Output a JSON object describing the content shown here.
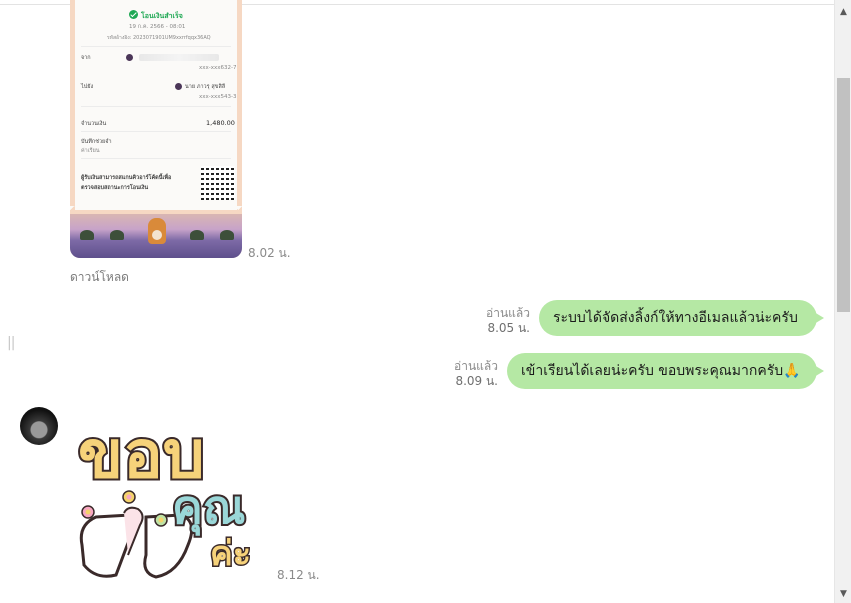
{
  "receipt": {
    "status": "โอนเงินสำเร็จ",
    "date": "19 ก.ค. 2566 - 08:01",
    "ref": "รหัสอ้างอิง: 2023071901UM9xxrrfqqx36AQ",
    "from_label": "จาก",
    "from_account": "xxx-xxx632-7",
    "to_label": "ไปยัง",
    "to_name": "นาย ภาวรุ สุขสิลี",
    "to_account": "xxx-xxx543-3",
    "amount_label": "จำนวนเงิน",
    "amount": "1,480.00",
    "memo_label": "บันทึกช่วยจำ",
    "memo_value": "ค่าเรียน",
    "qr_note_1": "ผู้รับเงินสามารถสแกนคิวอาร์โค้ดนี้เพื่อ",
    "qr_note_2": "ตรวจสอบสถานะการโอนเงิน"
  },
  "image_time": "8.02 น.",
  "download_label": "ดาวน์โหลด",
  "messages": [
    {
      "read": "อ่านแล้ว",
      "time": "8.05 น.",
      "text": "ระบบได้จัดส่งลิ้งก์ให้ทางอีเมลแล้วน่ะครับ"
    },
    {
      "read": "อ่านแล้ว",
      "time": "8.09 น.",
      "text": "เข้าเรียนได้เลยน่ะครับ  ขอบพระคุณมากครับ🙏"
    }
  ],
  "sticker": {
    "line1": "ขอบ",
    "line2": "คุณ",
    "line3": "ค่ะ",
    "time": "8.12 น."
  },
  "scroll_up_icon": "▲",
  "scroll_down_icon": "▼",
  "colors": {
    "bubble": "#b5e8a4",
    "receipt_border": "#f6d8c3",
    "ok_green": "#1fa854"
  }
}
